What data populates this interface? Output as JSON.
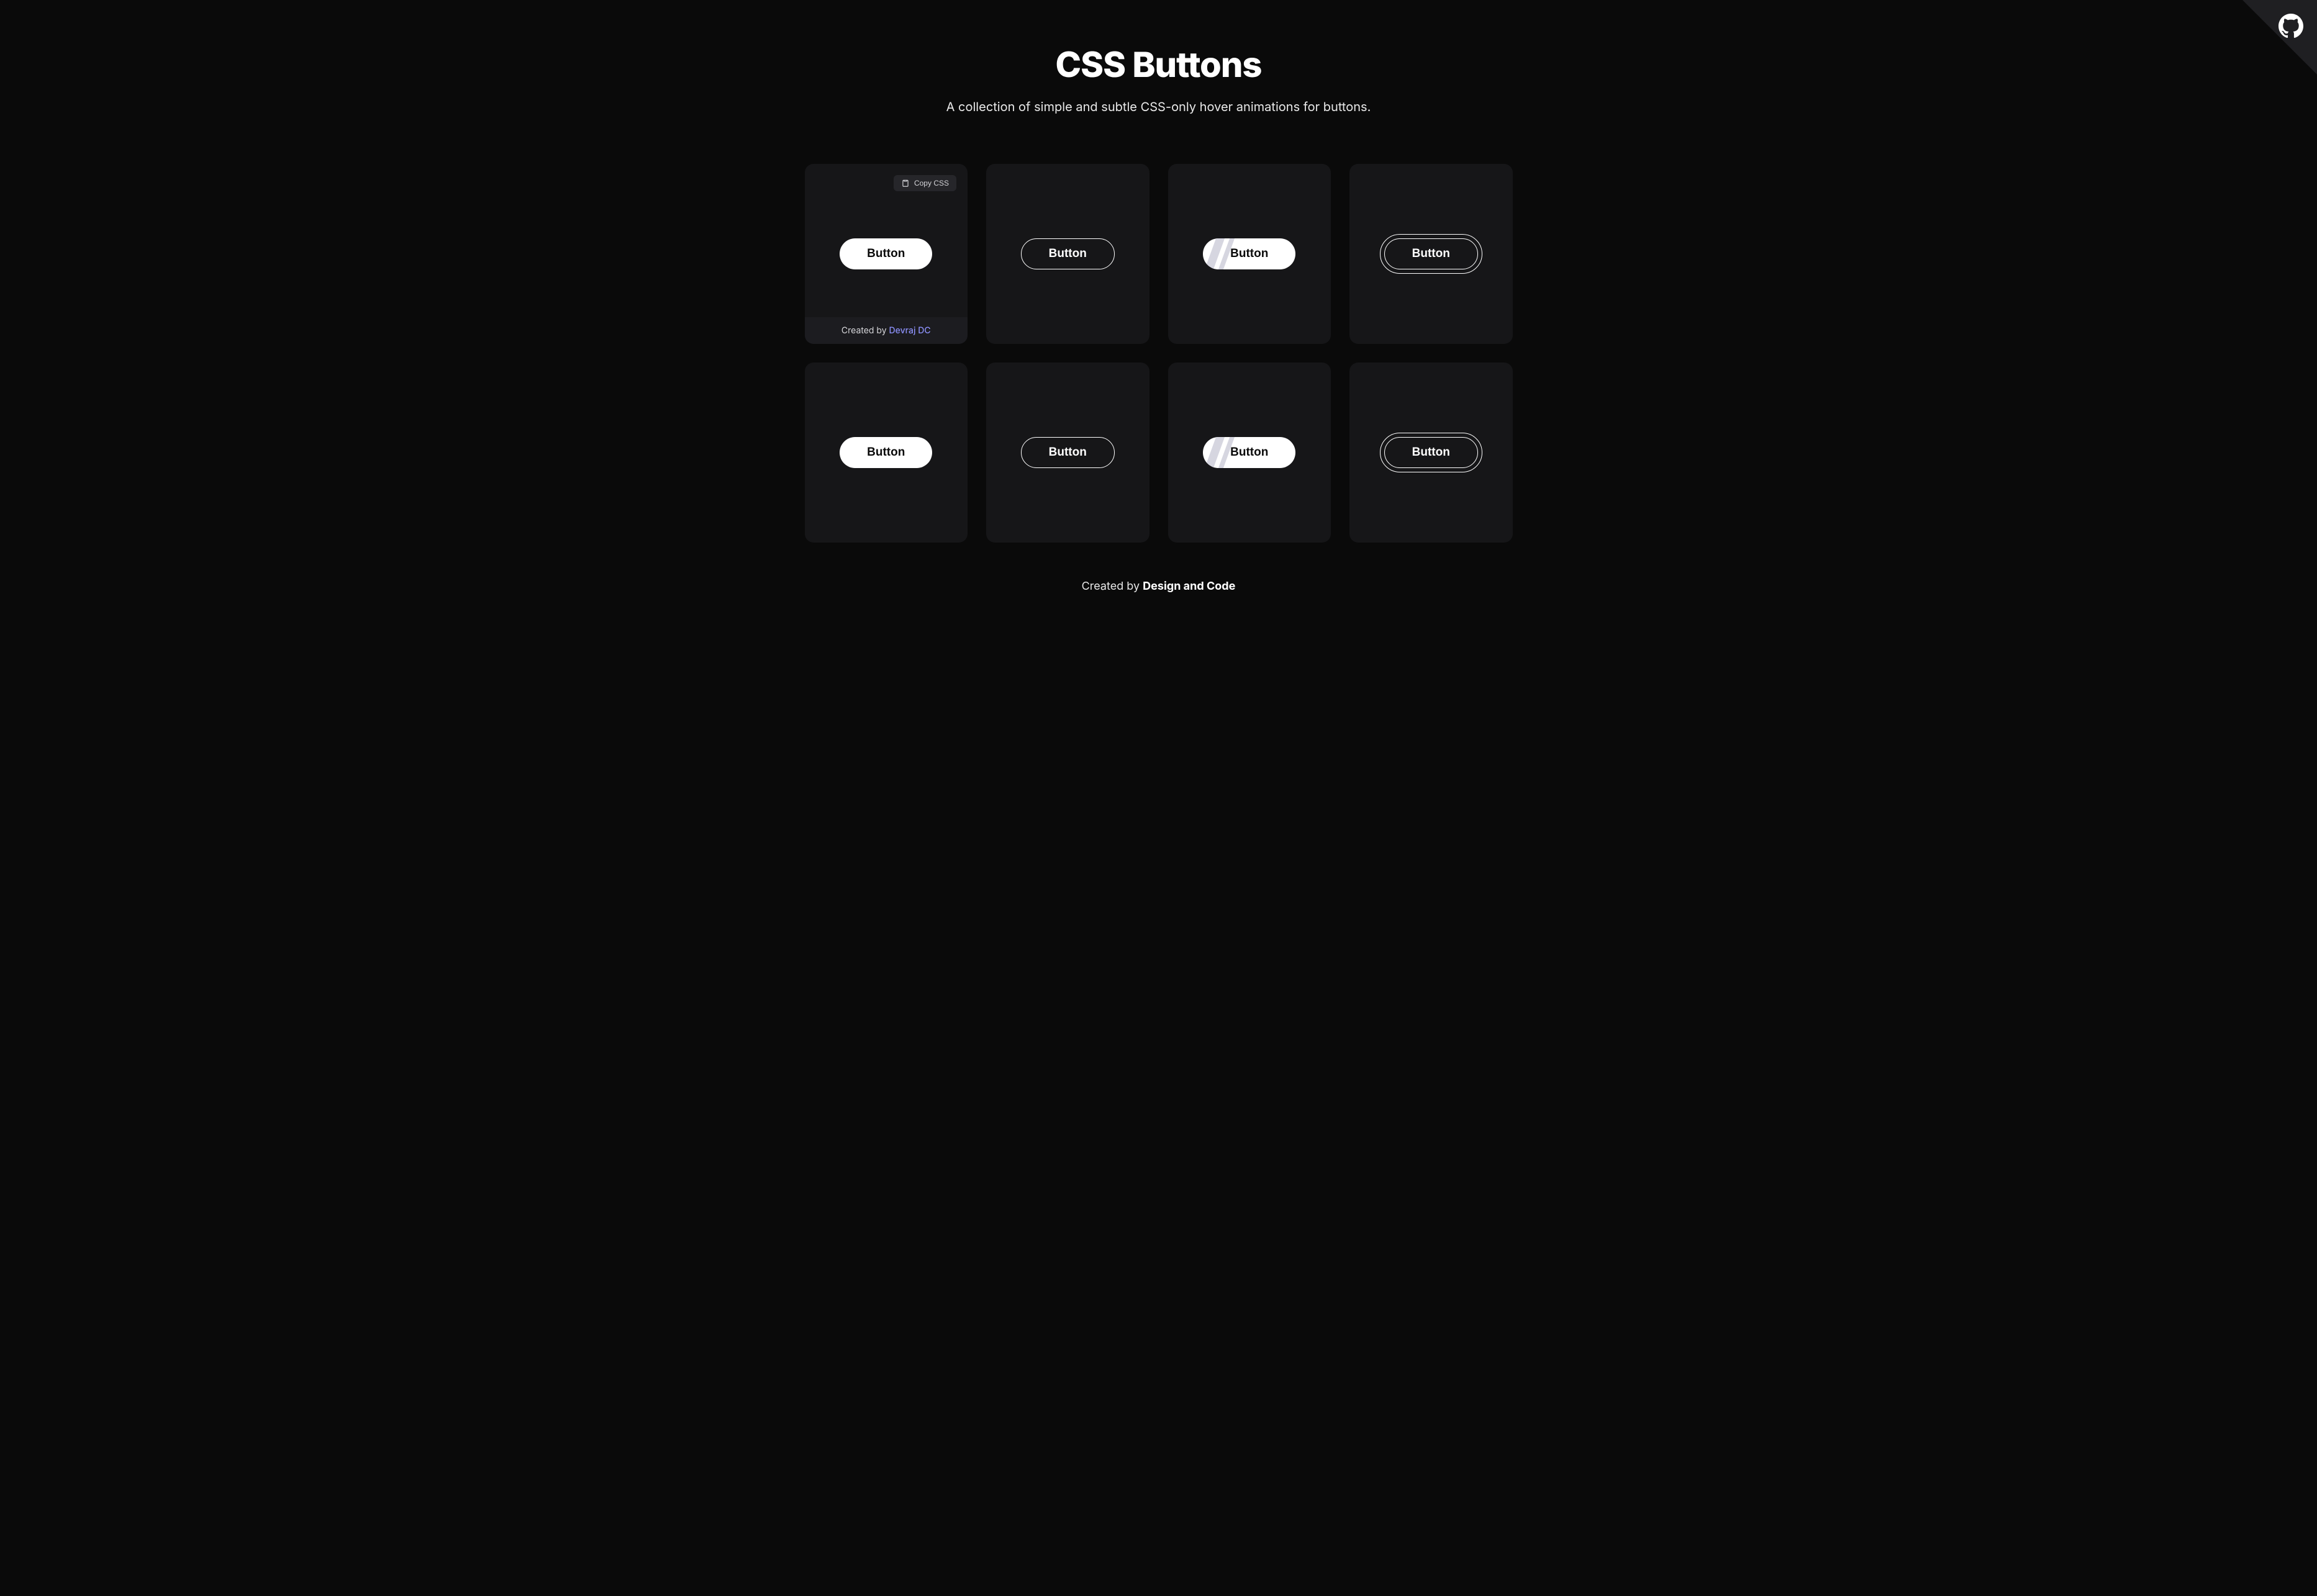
{
  "header": {
    "title": "CSS Buttons",
    "subtitle": "A collection of simple and subtle CSS-only hover animations for buttons."
  },
  "copy": {
    "label": "Copy CSS"
  },
  "cards": [
    {
      "button_label": "Button",
      "created_by_prefix": "Created by ",
      "author": "Devraj DC",
      "show_meta": true
    },
    {
      "button_label": "Button",
      "show_meta": false
    },
    {
      "button_label": "Button",
      "show_meta": false
    },
    {
      "button_label": "Button",
      "show_meta": false
    },
    {
      "button_label": "Button",
      "show_meta": false
    },
    {
      "button_label": "Button",
      "show_meta": false
    },
    {
      "button_label": "Button",
      "show_meta": false
    },
    {
      "button_label": "Button",
      "show_meta": false
    }
  ],
  "footer": {
    "prefix": "Created by ",
    "author": "Design and Code"
  }
}
